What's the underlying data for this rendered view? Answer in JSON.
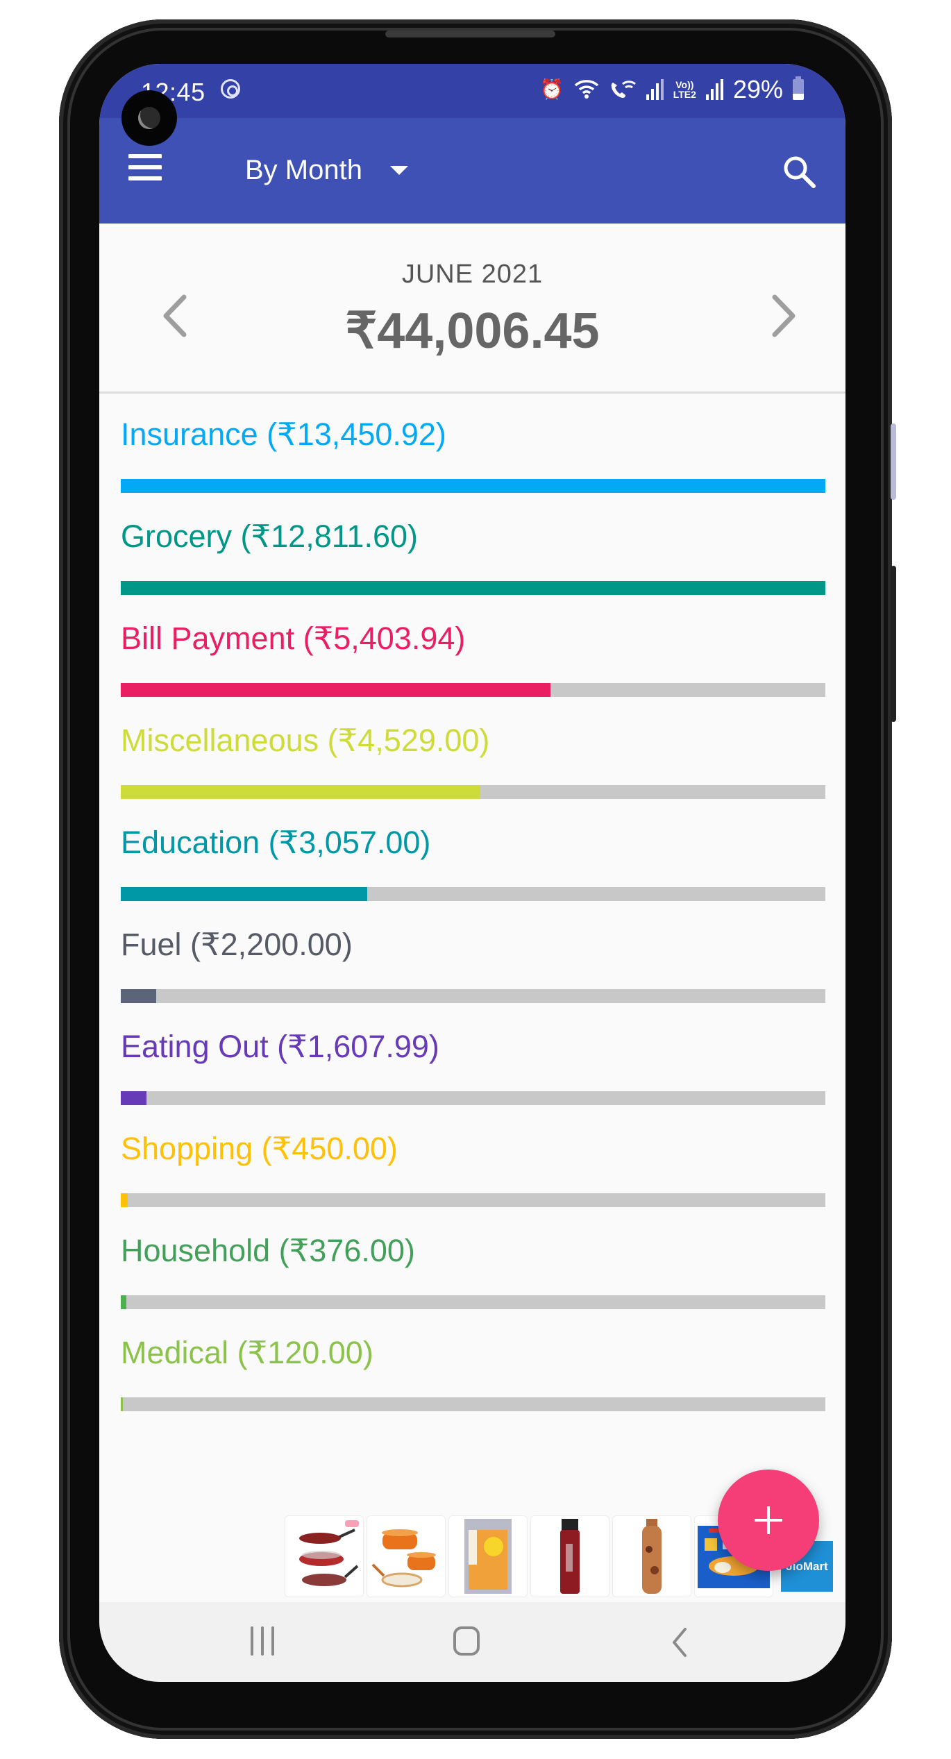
{
  "status_bar": {
    "time": "12:45",
    "battery": "29%",
    "icons": [
      "sync-icon",
      "alarm-icon",
      "wifi-icon",
      "wifi-calling-icon",
      "signal-sim1-icon",
      "volte-lte2-icon",
      "signal-sim2-icon",
      "battery-icon"
    ],
    "lte_top": "Vo))",
    "lte_bottom": "LTE2"
  },
  "toolbar": {
    "menu_icon": "hamburger-menu-icon",
    "view_mode": "By Month",
    "dropdown_icon": "caret-down-icon",
    "search_icon": "search-icon",
    "colors": {
      "primary": "#3f51b5",
      "status": "#3441a6"
    }
  },
  "header": {
    "period": "JUNE 2021",
    "total": "₹44,006.45",
    "prev_icon": "chevron-left-icon",
    "next_icon": "chevron-right-icon"
  },
  "categories": [
    {
      "name": "Insurance",
      "amount": "₹13,450.92",
      "label": "Insurance (₹13,450.92)",
      "fill_fraction": 1.0,
      "color": "#03a9f4"
    },
    {
      "name": "Grocery",
      "amount": "₹12,811.60",
      "label": "Grocery (₹12,811.60)",
      "fill_fraction": 1.0,
      "color": "#009688"
    },
    {
      "name": "Bill Payment",
      "amount": "₹5,403.94",
      "label": "Bill Payment (₹5,403.94)",
      "fill_fraction": 0.61,
      "color": "#e91e63"
    },
    {
      "name": "Miscellaneous",
      "amount": "₹4,529.00",
      "label": "Miscellaneous (₹4,529.00)",
      "fill_fraction": 0.51,
      "color": "#cddc39"
    },
    {
      "name": "Education",
      "amount": "₹3,057.00",
      "label": "Education (₹3,057.00)",
      "fill_fraction": 0.35,
      "color": "#0097a7"
    },
    {
      "name": "Fuel",
      "amount": "₹2,200.00",
      "label": "Fuel (₹2,200.00)",
      "fill_fraction": 0.05,
      "color": "#5c6479",
      "text_color": "#555a66"
    },
    {
      "name": "Eating Out",
      "amount": "₹1,607.99",
      "label": "Eating Out (₹1,607.99)",
      "fill_fraction": 0.036,
      "color": "#673ab7"
    },
    {
      "name": "Shopping",
      "amount": "₹450.00",
      "label": "Shopping (₹450.00)",
      "fill_fraction": 0.01,
      "color": "#ffc107"
    },
    {
      "name": "Household",
      "amount": "₹376.00",
      "label": "Household (₹376.00)",
      "fill_fraction": 0.008,
      "color": "#4caf50",
      "text_color": "#43a05a"
    },
    {
      "name": "Medical",
      "amount": "₹120.00",
      "label": "Medical (₹120.00)",
      "fill_fraction": 0.003,
      "color": "#8bc34a"
    }
  ],
  "ad_banner": {
    "items": [
      "cookware-set",
      "ceramic-cookware-set",
      "sunflower-oil-tin",
      "deodorant-spray",
      "copper-bottle",
      "idli-dosa-batter-pack"
    ],
    "brand": "JioMart"
  },
  "fab": {
    "icon": "plus-icon",
    "color": "#f53d78"
  },
  "system_nav": {
    "recents_icon": "recents-icon",
    "home_icon": "home-icon",
    "back_icon": "back-icon"
  }
}
